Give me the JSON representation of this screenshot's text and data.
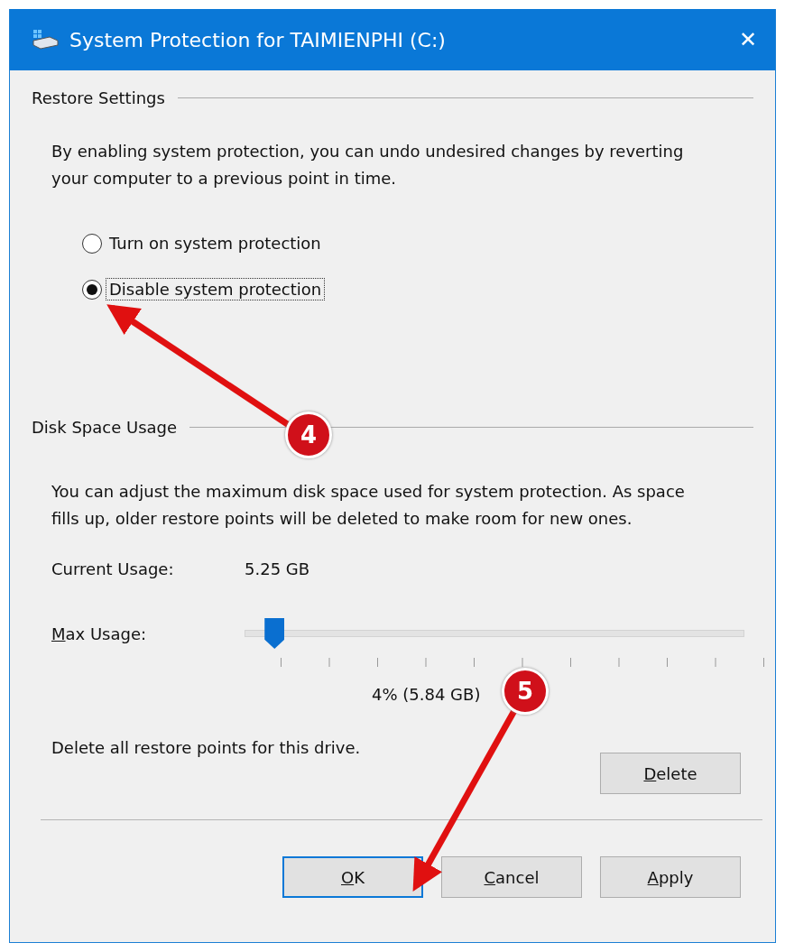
{
  "window": {
    "title": "System Protection for TAIMIENPHI (C:)",
    "close": "✕"
  },
  "restore_settings": {
    "heading": "Restore Settings",
    "description": "By enabling system protection, you can undo undesired changes by reverting your computer to a previous point in time.",
    "options": [
      {
        "label": "Turn on system protection",
        "selected": false
      },
      {
        "label": "Disable system protection",
        "selected": true
      }
    ]
  },
  "disk_space": {
    "heading": "Disk Space Usage",
    "description": "You can adjust the maximum disk space used for system protection. As space fills up, older restore points will be deleted to make room for new ones.",
    "current_usage_label": "Current Usage:",
    "current_usage_value": "5.25 GB",
    "max_usage": {
      "label_key": "M",
      "label_rest": "ax Usage:",
      "level": 0.06,
      "reading": "4% (5.84 GB)"
    },
    "delete_text": "Delete all restore points for this drive.",
    "delete_button": {
      "key": "D",
      "rest": "elete"
    }
  },
  "buttons": [
    {
      "key": "O",
      "rest": "K",
      "default": true
    },
    {
      "key": "C",
      "rest": "ancel",
      "default": false
    },
    {
      "key": "A",
      "rest": "pply",
      "default": false
    }
  ],
  "annotations": [
    {
      "label": "4"
    },
    {
      "label": "5"
    }
  ]
}
